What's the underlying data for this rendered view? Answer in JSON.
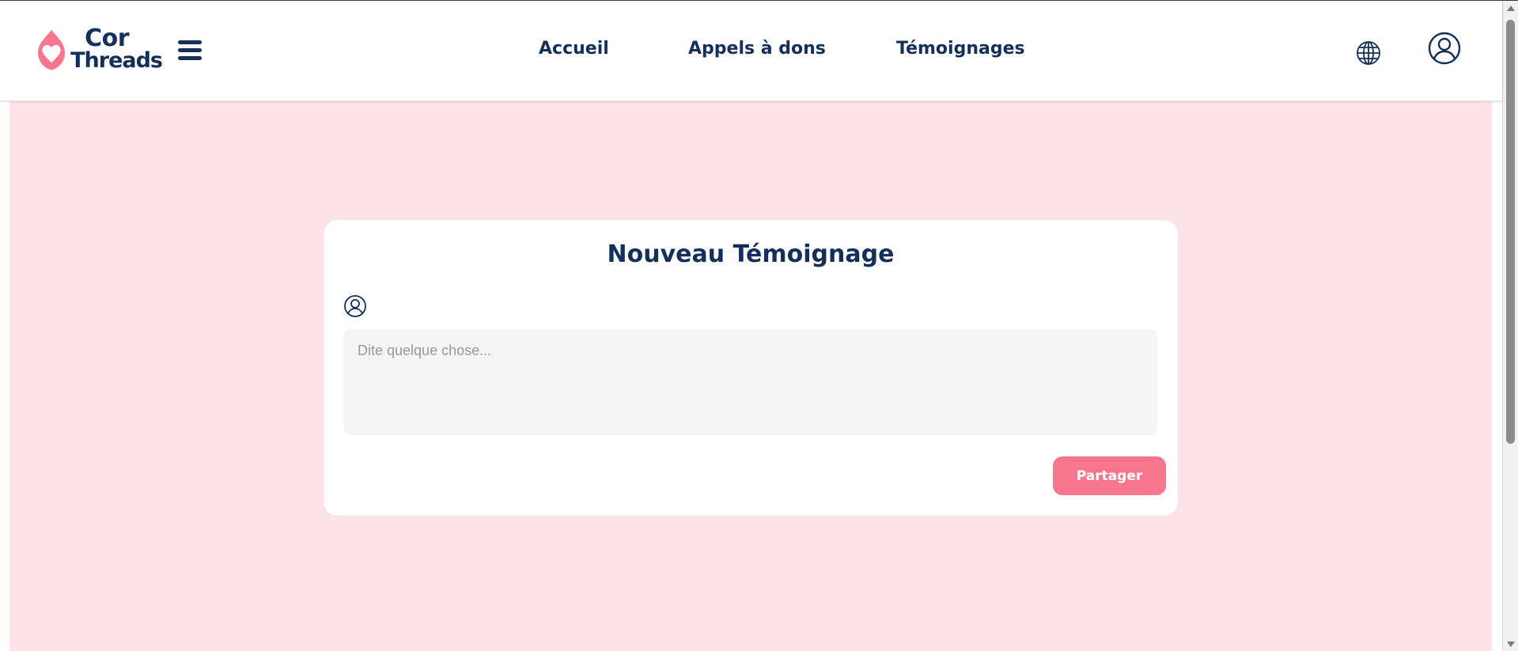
{
  "brand": {
    "name_line1": "Cor",
    "name_line2": "Threads",
    "accent_color": "#f7768d",
    "text_color": "#14305a"
  },
  "header": {
    "menu_icon": "hamburger-menu-icon",
    "nav": [
      {
        "label": "Accueil"
      },
      {
        "label": "Appels à dons"
      },
      {
        "label": "Témoignages"
      }
    ],
    "language_icon": "globe-icon",
    "account_icon": "user-circle-icon"
  },
  "main": {
    "background_color": "#fde3e7",
    "card": {
      "title": "Nouveau Témoignage",
      "avatar_icon": "user-circle-icon",
      "input": {
        "placeholder": "Dite quelque chose...",
        "value": ""
      },
      "submit_label": "Partager"
    }
  }
}
